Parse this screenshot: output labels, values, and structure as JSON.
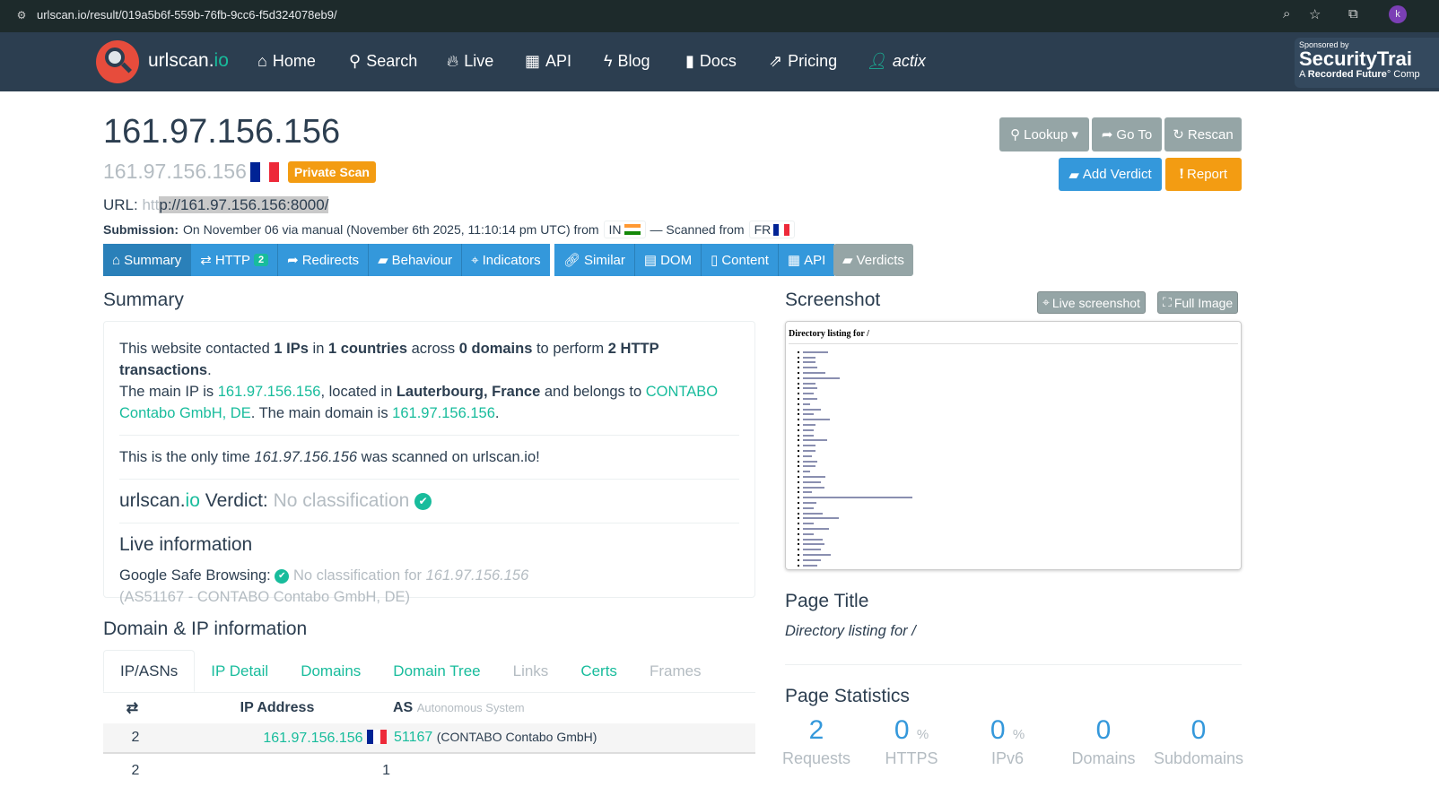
{
  "browser": {
    "url": "urlscan.io/result/019a5b6f-559b-76fb-9cc6-f5d324078eb9/"
  },
  "nav": {
    "brand_main": "urlscan.",
    "brand_accent": "io",
    "items": [
      {
        "label": "Home",
        "icon": "home-icon"
      },
      {
        "label": "Search",
        "icon": "search-icon"
      },
      {
        "label": "Live",
        "icon": "fire-icon"
      },
      {
        "label": "API",
        "icon": "qrcode-icon"
      },
      {
        "label": "Blog",
        "icon": "bolt-icon"
      },
      {
        "label": "Docs",
        "icon": "bookmark-icon"
      },
      {
        "label": "Pricing",
        "icon": "external-link-icon"
      },
      {
        "label": "actix",
        "icon": "user-icon"
      }
    ],
    "sponsor": {
      "line1": "Sponsored by",
      "line2": "SecurityTrai",
      "line3_bold": "Recorded Future",
      "line3_pre": "A ",
      "line3_post": "° Comp"
    }
  },
  "header": {
    "title": "161.97.156.156",
    "subtitle_ip": "161.97.156.156",
    "private_badge": "Private Scan",
    "url_label": "URL:",
    "url_faint": "htt",
    "url_rest": "p://161.97.156.156:8000/",
    "submission_label": "Submission:",
    "submission_text": "On November 06 via manual (November 6th 2025, 11:10:14 pm UTC) from",
    "from_cc": "IN",
    "scanned_text": "— Scanned from",
    "scanned_cc": "FR"
  },
  "actions": {
    "lookup": "Lookup",
    "goto": "Go To",
    "rescan": "Rescan",
    "add_verdict": "Add Verdict",
    "report": "Report"
  },
  "tabs": [
    {
      "label": "Summary"
    },
    {
      "label": "HTTP",
      "count": "2"
    },
    {
      "label": "Redirects"
    },
    {
      "label": "Behaviour"
    },
    {
      "label": "Indicators"
    },
    {
      "label": "Similar"
    },
    {
      "label": "DOM"
    },
    {
      "label": "Content"
    },
    {
      "label": "API"
    },
    {
      "label": "Verdicts"
    }
  ],
  "summary": {
    "heading": "Summary",
    "p1": {
      "a": "This website contacted ",
      "ips": "1 IPs",
      "b": " in ",
      "countries": "1 countries",
      "c": " across ",
      "domains": "0 domains",
      "d": " to perform ",
      "tx": "2 HTTP transactions",
      "e": ".",
      "f": "The main IP is ",
      "ip": "161.97.156.156",
      "g": ", located in ",
      "loc": "Lauterbourg, France",
      "h": " and belongs to ",
      "asn": "CONTABO Contabo GmbH, DE",
      "i": ". The main domain is ",
      "domain": "161.97.156.156",
      "j": "."
    },
    "p2": {
      "a": "This is the only time ",
      "ip": "161.97.156.156",
      "b": " was scanned on urlscan.io!"
    },
    "verdict": {
      "brand": "urlscan.",
      "accent": "io",
      "label": " Verdict: ",
      "value": "No classification"
    },
    "live": {
      "heading": "Live information",
      "gsb_label": "Google Safe Browsing:",
      "gsb_value": "No classification for ",
      "gsb_ip": "161.97.156.156",
      "asn_line": "(AS51167 - CONTABO Contabo GmbH, DE)"
    }
  },
  "screenshot": {
    "heading": "Screenshot",
    "live_btn": "Live screenshot",
    "full_btn": "Full Image",
    "page_heading": "Directory listing for /"
  },
  "page_title": {
    "heading": "Page Title",
    "value": "Directory listing for /"
  },
  "domain_ip": {
    "heading": "Domain & IP information",
    "tabs": [
      {
        "label": "IP/ASNs"
      },
      {
        "label": "IP Detail"
      },
      {
        "label": "Domains"
      },
      {
        "label": "Domain Tree"
      },
      {
        "label": "Links"
      },
      {
        "label": "Certs"
      },
      {
        "label": "Frames"
      }
    ],
    "columns": {
      "ip": "IP Address",
      "as": "AS",
      "as_sub": "Autonomous System"
    },
    "rows": [
      {
        "count": "2",
        "ip": "161.97.156.156",
        "asn": "51167",
        "asn_name": "(CONTABO Contabo GmbH)"
      },
      {
        "count": "2",
        "ip": "1"
      }
    ]
  },
  "stats": {
    "heading": "Page Statistics",
    "items": [
      {
        "value": "2",
        "unit": "",
        "label": "Requests"
      },
      {
        "value": "0",
        "unit": "%",
        "label": "HTTPS"
      },
      {
        "value": "0",
        "unit": "%",
        "label": "IPv6"
      },
      {
        "value": "0",
        "unit": "",
        "label": "Domains"
      },
      {
        "value": "0",
        "unit": "",
        "label": "Subdomains"
      }
    ]
  },
  "colors": {
    "nav": "#2c3e50",
    "accent": "#18bc9c",
    "primary": "#3498db",
    "warning": "#f39c12",
    "muted": "#95a5a6"
  }
}
